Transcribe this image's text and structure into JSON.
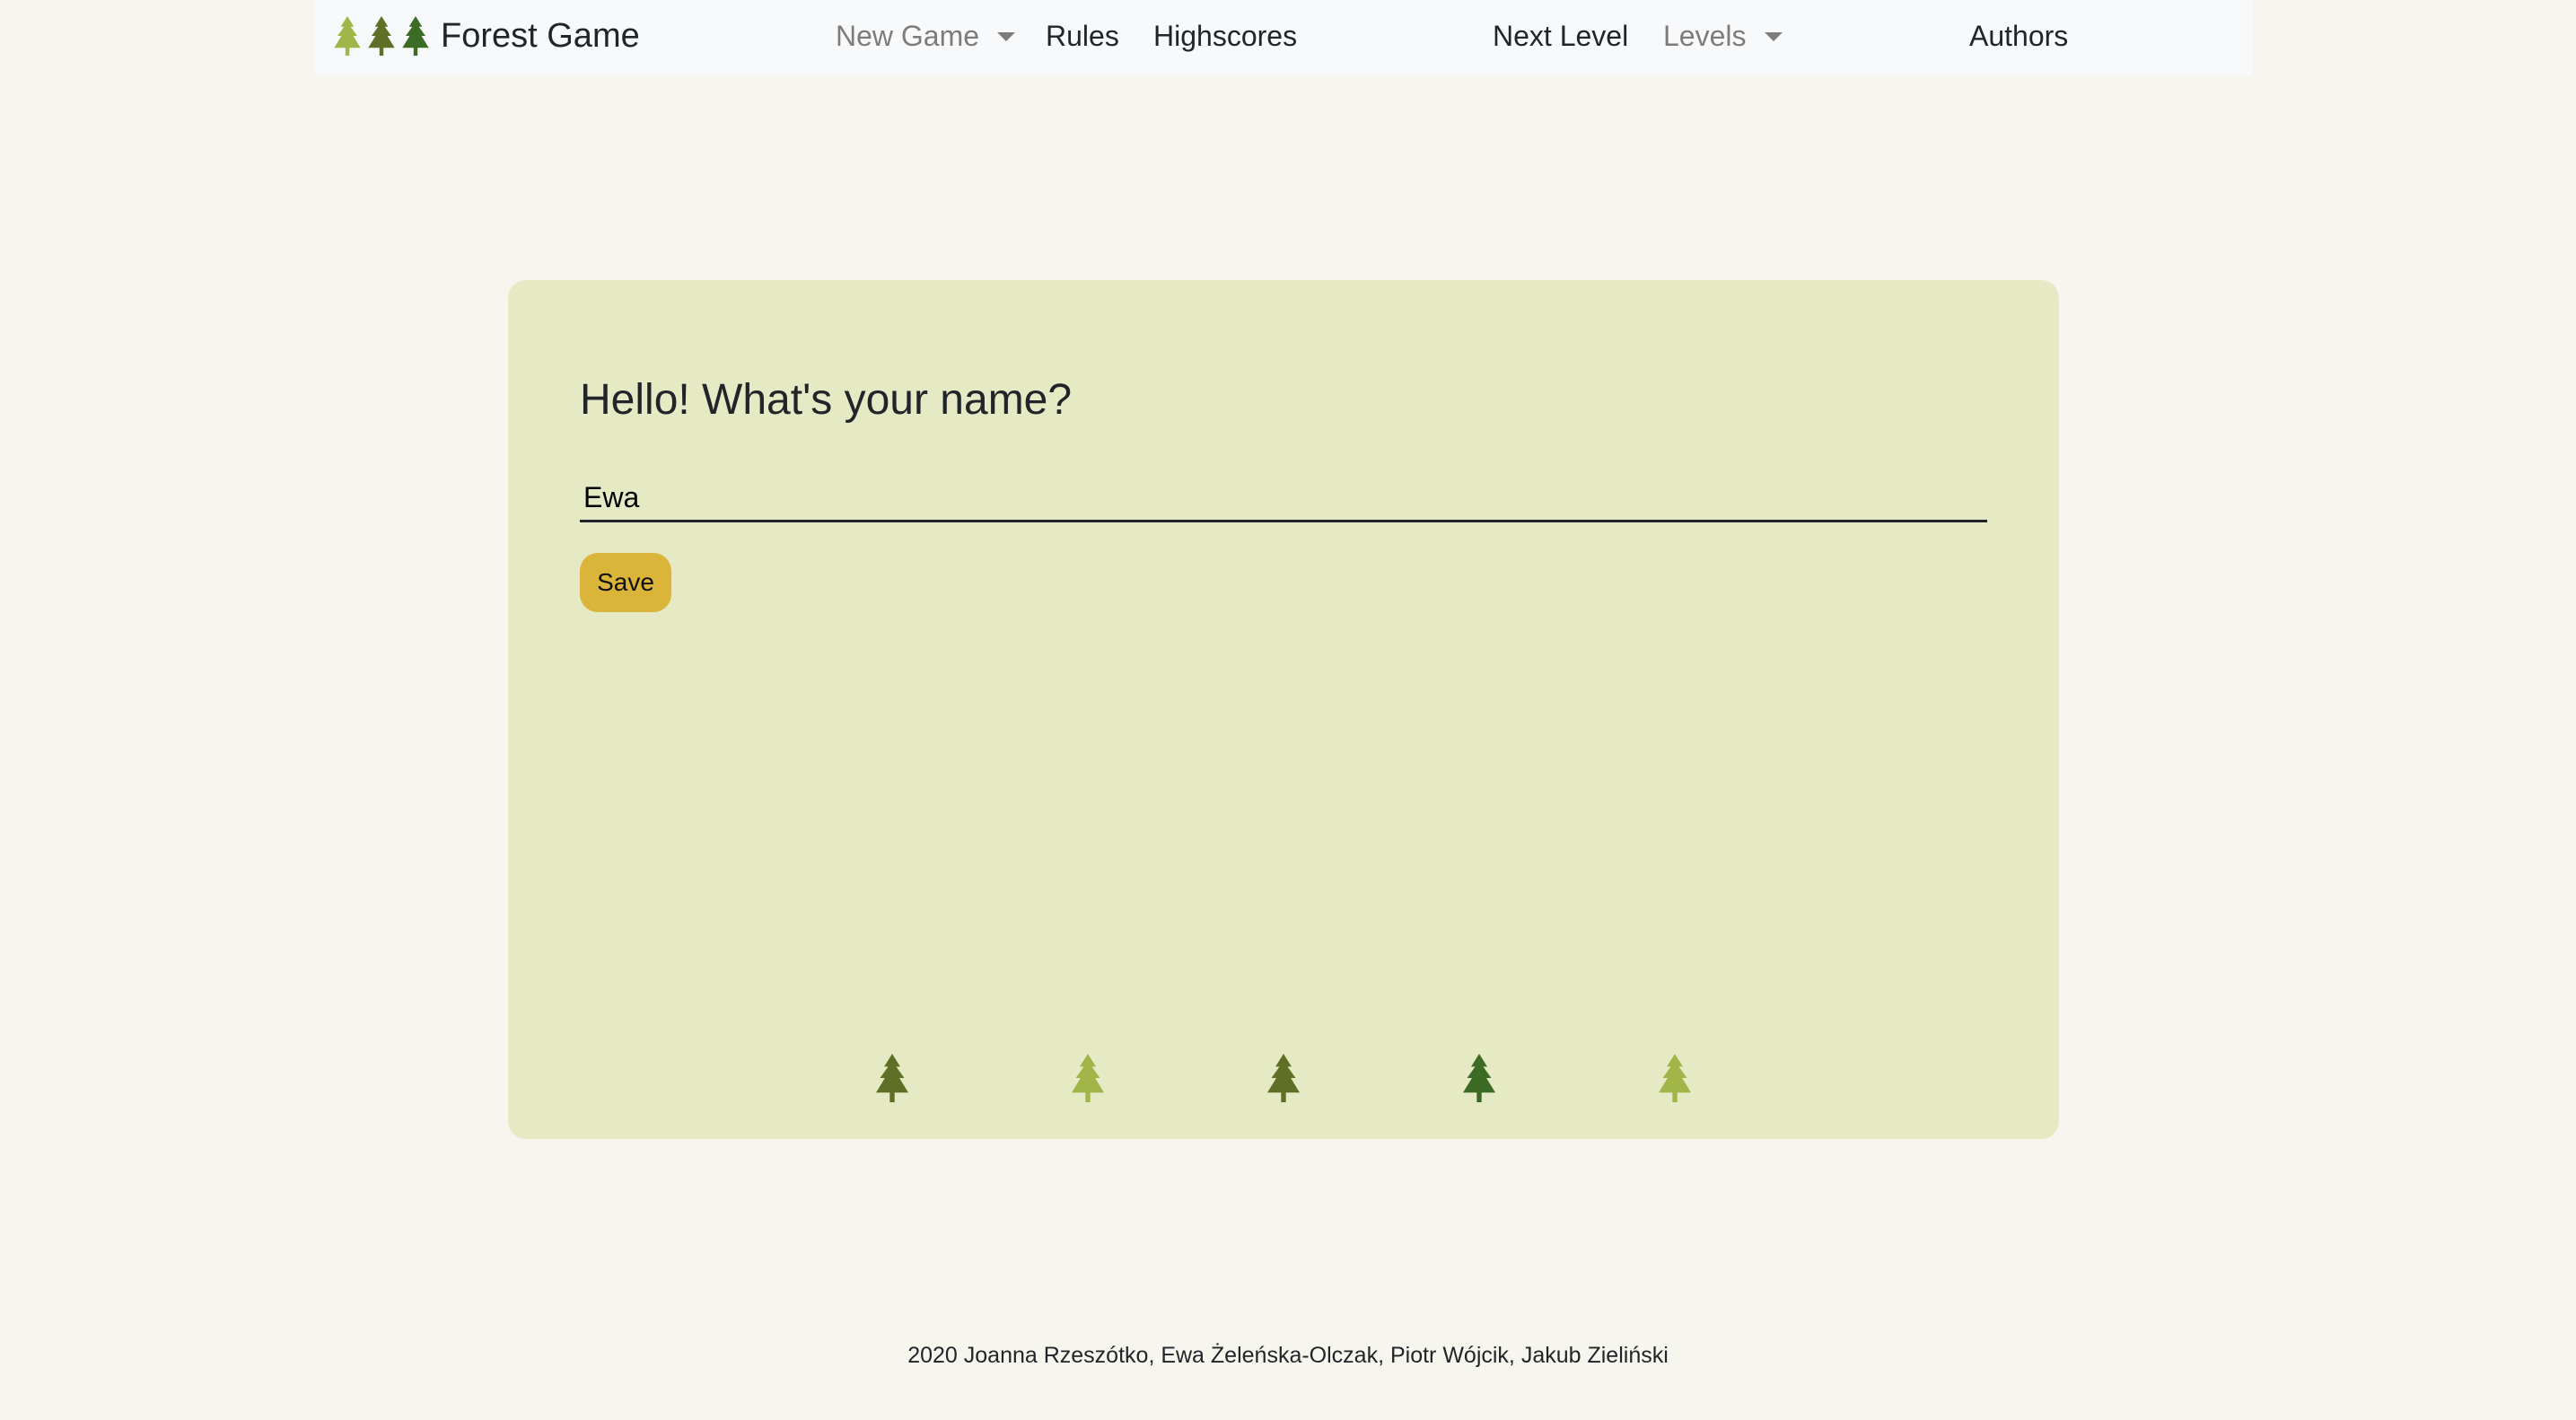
{
  "navbar": {
    "brand": {
      "title": "Forest Game",
      "icons": [
        {
          "icon": "pine-tree-icon",
          "color": "#a2b548"
        },
        {
          "icon": "pine-tree-icon",
          "color": "#5f7026"
        },
        {
          "icon": "pine-tree-icon",
          "color": "#3c6b26"
        }
      ]
    },
    "new_game_label": "New Game",
    "rules_label": "Rules",
    "highscores_label": "Highscores",
    "next_level_label": "Next Level",
    "levels_label": "Levels",
    "authors_label": "Authors"
  },
  "card": {
    "title": "Hello! What's your name?",
    "name_input": {
      "value": "Ewa",
      "placeholder": ""
    },
    "save_label": "Save",
    "trees": [
      {
        "icon": "pine-tree-icon",
        "color": "#5f7026"
      },
      {
        "icon": "pine-tree-icon",
        "color": "#a2b548"
      },
      {
        "icon": "pine-tree-icon",
        "color": "#5f7026"
      },
      {
        "icon": "pine-tree-icon",
        "color": "#3c6b26"
      },
      {
        "icon": "pine-tree-icon",
        "color": "#a2b548"
      }
    ]
  },
  "footer": {
    "text": "2020 Joanna Rzeszótko, Ewa Żeleńska-Olczak, Piotr Wójcik, Jakub Zieliński"
  },
  "colors": {
    "page_background": "#f7f6ee",
    "navbar_background": "#f8f9fa",
    "card_background": "#e6eac4",
    "save_button": "#dbb43a"
  }
}
